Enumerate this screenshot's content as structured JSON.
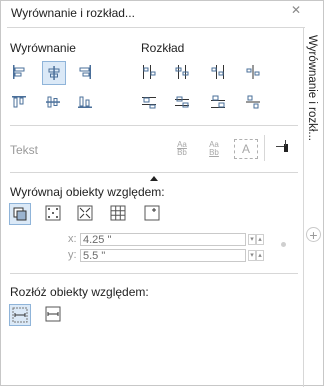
{
  "title": "Wyrównanie i rozkład...",
  "sections": {
    "alignment": "Wyrównanie",
    "distribution": "Rozkład",
    "text": "Tekst",
    "align_relative": "Wyrównaj obiekty względem:",
    "distribute_relative": "Rozłóż obiekty względem:"
  },
  "text_buttons": {
    "aa_top": "Aa",
    "bb_bottom": "Bb",
    "frame_a": "A"
  },
  "coords": {
    "x_label": "x:",
    "x_value": "4.25 \"",
    "y_label": "y:",
    "y_value": "5.5 \""
  },
  "side_tab": "Wyrównanie i rozkł...",
  "icons": {
    "close": "close-icon",
    "expand_arrow": "triangle-up-icon",
    "add_tab": "plus-icon"
  },
  "colors": {
    "border": "#c7c7c7",
    "accent_blue": "#2b6cb0",
    "disabled_grey": "#9a9a9a"
  }
}
